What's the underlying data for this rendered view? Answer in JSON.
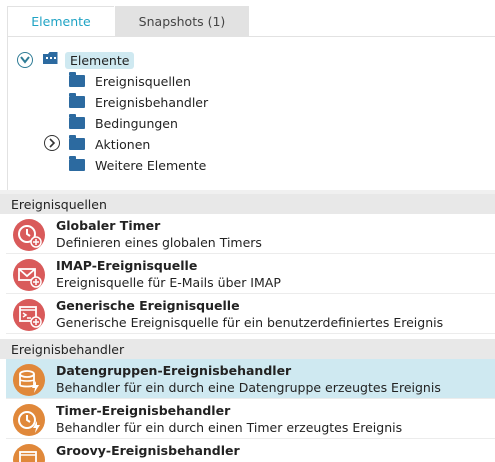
{
  "tabs": [
    {
      "label": "Elemente",
      "active": true
    },
    {
      "label": "Snapshots (1)",
      "active": false
    }
  ],
  "tree": {
    "root": {
      "label": "Elemente",
      "expanded": true
    },
    "children": [
      {
        "label": "Ereignisquellen",
        "expandable": false
      },
      {
        "label": "Ereignisbehandler",
        "expandable": false
      },
      {
        "label": "Bedingungen",
        "expandable": false
      },
      {
        "label": "Aktionen",
        "expandable": true
      },
      {
        "label": "Weitere Elemente",
        "expandable": false
      }
    ]
  },
  "sections": [
    {
      "header": "Ereignisquellen",
      "items": [
        {
          "title": "Globaler Timer",
          "description": "Definieren eines globalen Timers",
          "icon": "timer-add-icon",
          "selected": false
        },
        {
          "title": "IMAP-Ereignisquelle",
          "description": "Ereignisquelle für E-Mails über IMAP",
          "icon": "mail-add-icon",
          "selected": false
        },
        {
          "title": "Generische Ereignisquelle",
          "description": "Generische Ereignisquelle für ein benutzerdefiniertes Ereignis",
          "icon": "script-add-icon",
          "selected": false
        }
      ]
    },
    {
      "header": "Ereignisbehandler",
      "items": [
        {
          "title": "Datengruppen-Ereignisbehandler",
          "description": "Behandler für ein durch eine Datengruppe erzeugtes Ereignis",
          "icon": "database-handler-icon",
          "selected": true
        },
        {
          "title": "Timer-Ereignisbehandler",
          "description": "Behandler für ein durch einen Timer erzeugtes Ereignis",
          "icon": "timer-handler-icon",
          "selected": false
        },
        {
          "title": "Groovy-Ereignisbehandler",
          "description": "",
          "icon": "groovy-handler-icon",
          "selected": false
        }
      ]
    }
  ],
  "colors": {
    "accent": "#1fa3c4",
    "source_icon": "#d95a5a",
    "handler_icon": "#e0883a",
    "folder": "#2c6aa0",
    "selection": "#cfe9f1"
  }
}
